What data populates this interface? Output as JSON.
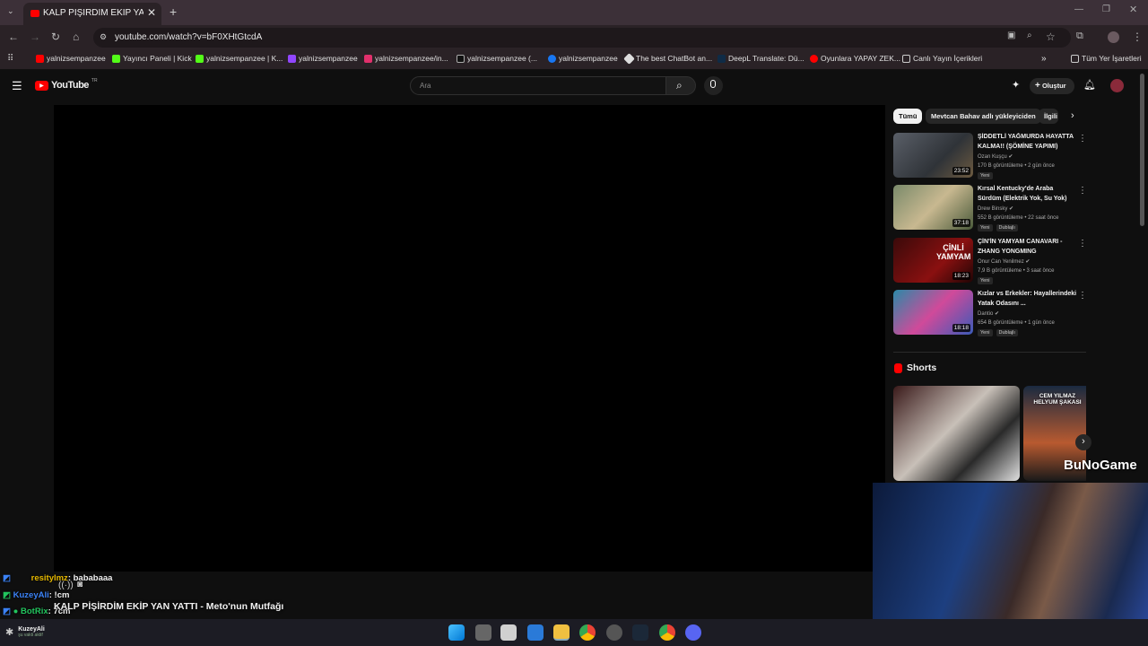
{
  "browser": {
    "tab_title": "KALP PİŞİRDİM EKİP YAN YATTI",
    "url": "youtube.com/watch?v=bF0XHtGtcdA",
    "bookmarks": [
      "yalnizsempanzee",
      "Yayıncı Paneli | Kick",
      "yalnizsempanzee | K...",
      "yalnizsempanzee",
      "yalnizsempanzee/in...",
      "yalnizsempanzee (...",
      "yalnizsempanzee",
      "The best ChatBot an...",
      "DeepL Translate: Dü...",
      "Oyunlara YAPAY ZEK...",
      "Canlı Yayın İçerikleri"
    ],
    "all_bookmarks": "Tüm Yer İşaretleri"
  },
  "youtube": {
    "logo": "YouTube",
    "logo_sup": "TR",
    "search_placeholder": "Ara",
    "create_label": "Oluştur",
    "chips": [
      "Tümü",
      "Mevtcan Bahav adlı yükleyiciden",
      "İlgili"
    ],
    "recommendations": [
      {
        "title": "ŞİDDETLİ YAĞMURDA HAYATTA KALMA!! (ŞÖMİNE YAPIMI)",
        "channel": "Ozan Kuşçu",
        "meta": "170 B görüntüleme • 2 gün önce",
        "badges": [
          "Yeni"
        ],
        "duration": "23:52"
      },
      {
        "title": "Kırsal Kentucky'de Araba Sürdüm (Elektrik Yok, Su Yok)",
        "channel": "Drew Binsky",
        "meta": "552 B görüntüleme • 22 saat önce",
        "badges": [
          "Yeni",
          "Dublajlı"
        ],
        "duration": "37:18"
      },
      {
        "title": "ÇİN'İN YAMYAM CANAVARI - ZHANG YONGMING",
        "channel": "Onur Can Yenilmez",
        "meta": "7,9 B görüntüleme • 3 saat önce",
        "badges": [
          "Yeni"
        ],
        "duration": "18:23"
      },
      {
        "title": "Kızlar vs Erkekler: Hayallerindeki Yatak Odasını ...",
        "channel": "Dantio",
        "meta": "654 B görüntüleme • 1 gün önce",
        "badges": [
          "Yeni",
          "Dublajlı"
        ],
        "duration": "18:18"
      }
    ],
    "shorts_label": "Shorts",
    "short2_caption": "CEM YILMAZ HELYUM ŞAKASI",
    "video_title": "KALP PİŞİRDİM EKİP YAN YATTI - Meto'nun Mutfağı"
  },
  "overlay": {
    "watermark": "BuNoGame",
    "chat": [
      {
        "user": "resitylmz",
        "msg": ": bababaaa",
        "color": "#e6b800"
      },
      {
        "user": "KuzeyAli",
        "msg": ": !cm",
        "color": "#3b82f6"
      },
      {
        "user": "BotRix",
        "msg": ": 7cm",
        "color": "#22c55e"
      }
    ],
    "yinyan_chars": "ÇİNLİ\nYAMYAM"
  },
  "taskbar": {
    "user": "KuzeyAli",
    "status": "şu vakti aktif"
  }
}
